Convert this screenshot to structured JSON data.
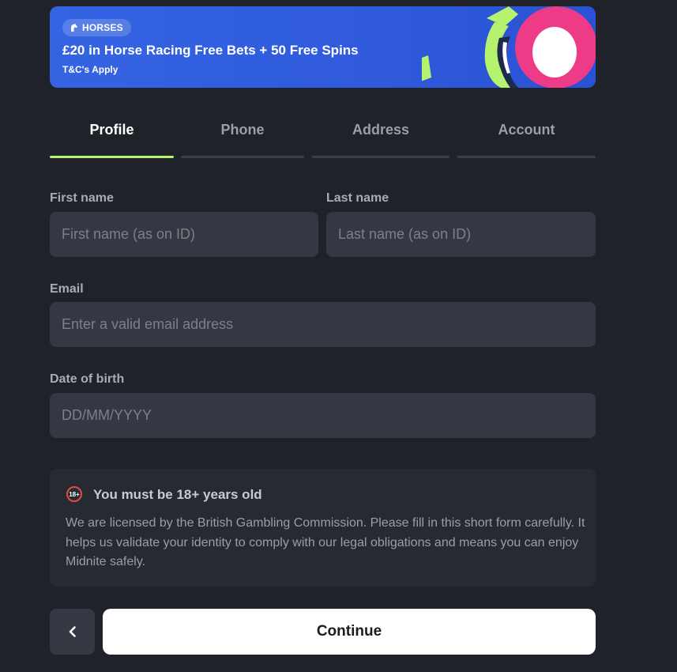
{
  "banner": {
    "badge": "HORSES",
    "badge_icon": "horse-icon",
    "title": "£20 in Horse Racing Free Bets + 50 Free Spins",
    "subtitle": "T&C's Apply"
  },
  "tabs": [
    {
      "label": "Profile",
      "active": true
    },
    {
      "label": "Phone",
      "active": false
    },
    {
      "label": "Address",
      "active": false
    },
    {
      "label": "Account",
      "active": false
    }
  ],
  "form": {
    "first_name": {
      "label": "First name",
      "placeholder": "First name (as on ID)",
      "value": ""
    },
    "last_name": {
      "label": "Last name",
      "placeholder": "Last name (as on ID)",
      "value": ""
    },
    "email": {
      "label": "Email",
      "placeholder": "Enter a valid email address",
      "value": ""
    },
    "dob": {
      "label": "Date of birth",
      "placeholder": "DD/MM/YYYY",
      "value": ""
    }
  },
  "notice": {
    "icon_text": "18+",
    "title": "You must be 18+ years old",
    "body": "We are licensed by the British Gambling Commission. Please fill in this short form carefully. It helps us validate your identity to comply with our legal obligations and means you can enjoy Midnite safely."
  },
  "actions": {
    "back_icon": "chevron-left-icon",
    "continue_label": "Continue"
  },
  "colors": {
    "background": "#1f2229",
    "banner_blue": "#3564e3",
    "active_tab_underline": "#b6f26e",
    "age_icon_red": "#e04a4a"
  }
}
